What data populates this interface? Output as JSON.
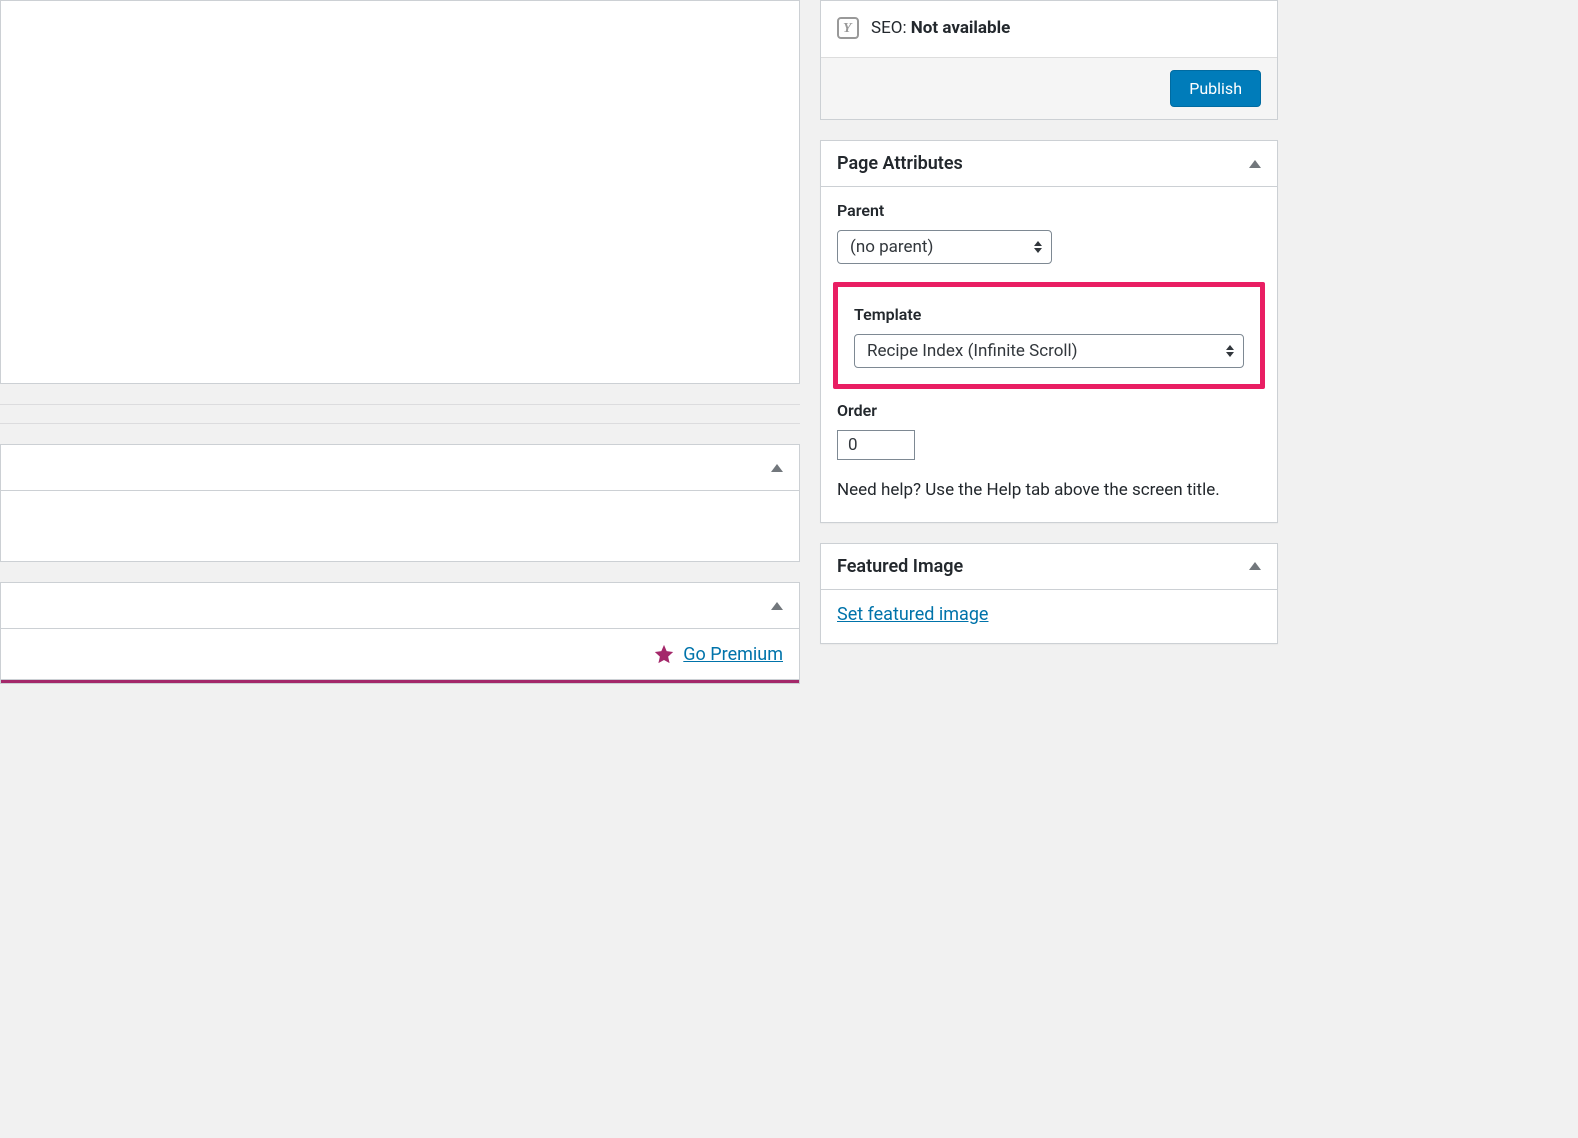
{
  "publish": {
    "seo_prefix": "SEO: ",
    "seo_value": "Not available",
    "publish_button": "Publish"
  },
  "page_attributes": {
    "title": "Page Attributes",
    "parent_label": "Parent",
    "parent_value": "(no parent)",
    "template_label": "Template",
    "template_value": "Recipe Index (Infinite Scroll)",
    "order_label": "Order",
    "order_value": "0",
    "help_text": "Need help? Use the Help tab above the screen title."
  },
  "featured_image": {
    "title": "Featured Image",
    "set_link": "Set featured image"
  },
  "premium": {
    "go_premium": "Go Premium"
  }
}
